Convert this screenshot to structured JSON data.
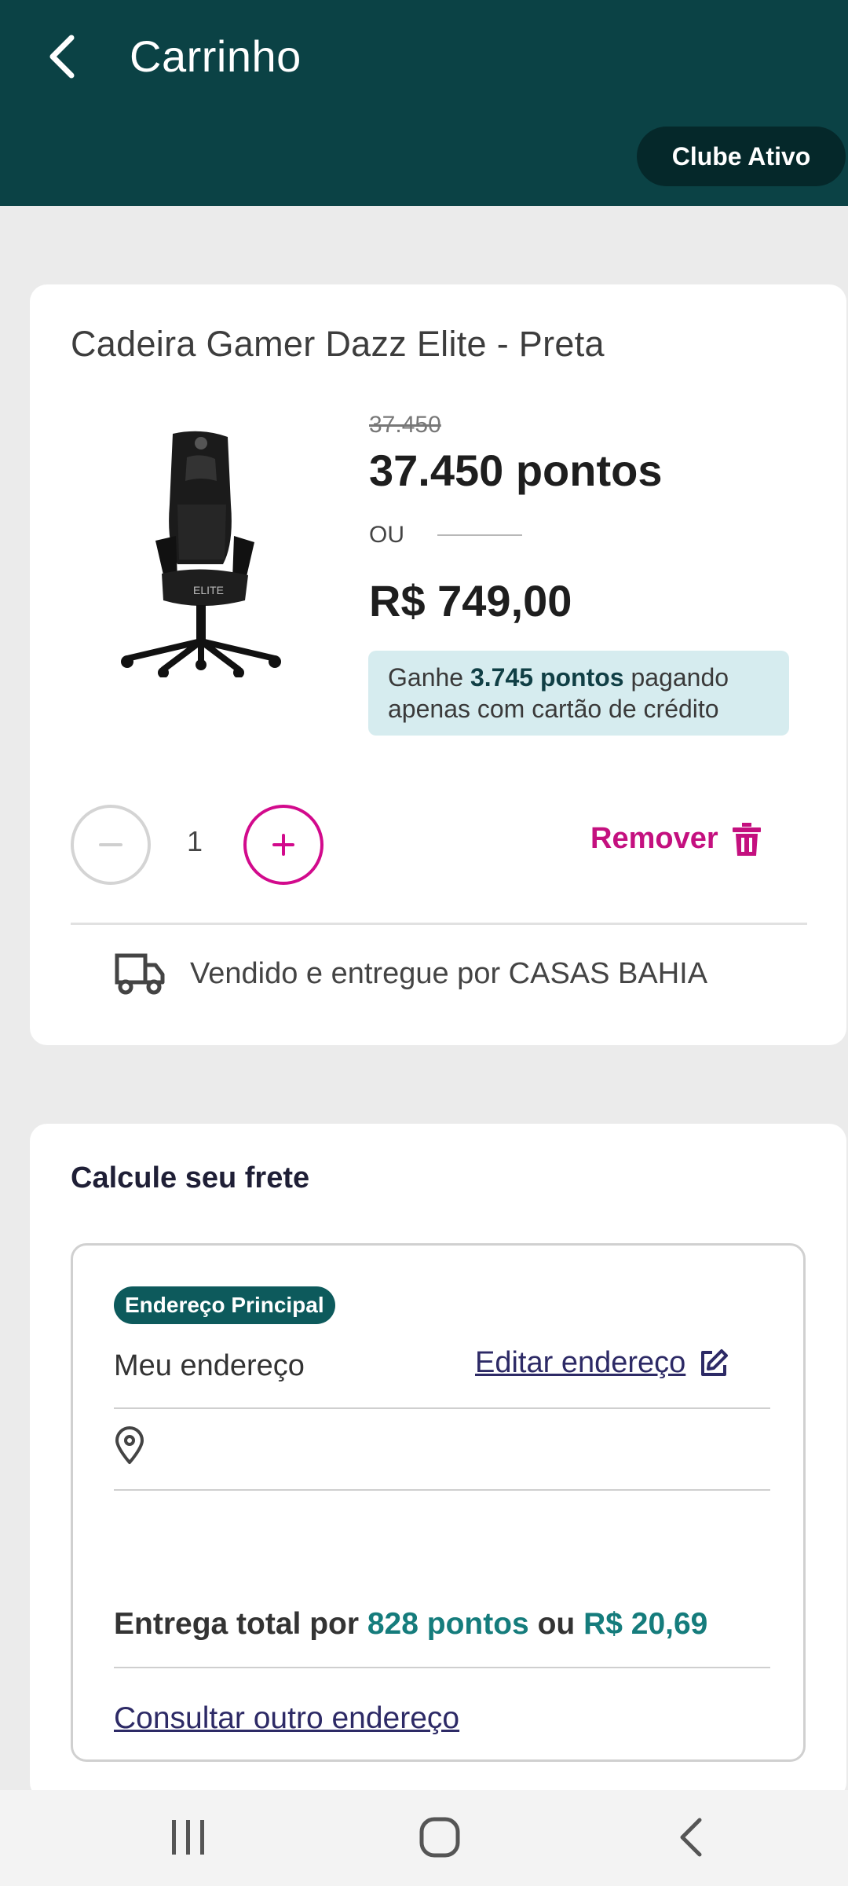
{
  "header": {
    "title": "Carrinho",
    "club_badge": "Clube Ativo",
    "background": "#0b4245"
  },
  "product": {
    "name": "Cadeira Gamer Dazz Elite - Preta",
    "image_icon": "gaming-chair-image",
    "image_logo_text": "ELITE",
    "old_price": "37.450",
    "points_price": "37.450 pontos",
    "or_label": "OU",
    "money_price": "R$ 749,00",
    "cashback_prefix": "Ganhe ",
    "cashback_points": "3.745 pontos",
    "cashback_suffix": " pagando apenas com cartão de crédito",
    "quantity": "1",
    "remove_label": "Remover",
    "seller_text": "Vendido e entregue por CASAS BAHIA",
    "accent_color": "#d20a8c"
  },
  "shipping": {
    "title": "Calcule seu frete",
    "address_badge": "Endereço Principal",
    "address_name": "Meu endereço",
    "edit_link": "Editar endereço",
    "delivery_prefix": "Entrega total por ",
    "delivery_points": "828 pontos",
    "delivery_middle": " ou ",
    "delivery_money": "R$ 20,69",
    "other_address_link": "Consultar outro endereço"
  },
  "navbar": {
    "items": [
      "recent-apps-icon",
      "home-icon",
      "back-icon"
    ]
  }
}
